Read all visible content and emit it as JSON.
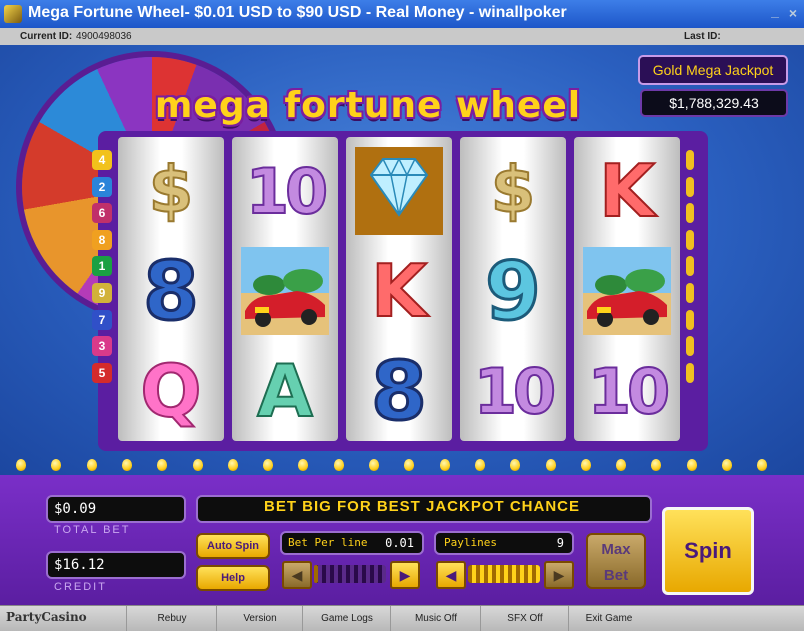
{
  "window": {
    "title": "Mega Fortune Wheel- $0.01 USD to $90 USD - Real Money - winallpoker"
  },
  "id_bar": {
    "current_label": "Current ID:",
    "current_value": "4900498036",
    "last_label": "Last ID:"
  },
  "logo": "mega fortune wheel",
  "jackpot": {
    "label": "Gold Mega Jackpot",
    "value": "$1,788,329.43"
  },
  "paylines_left": [
    {
      "n": "4",
      "color": "#f2c21b"
    },
    {
      "n": "2",
      "color": "#2a84d9"
    },
    {
      "n": "6",
      "color": "#c0306a"
    },
    {
      "n": "8",
      "color": "#f0a020"
    },
    {
      "n": "1",
      "color": "#1aa043"
    },
    {
      "n": "9",
      "color": "#d2b23a"
    },
    {
      "n": "7",
      "color": "#3050c8"
    },
    {
      "n": "3",
      "color": "#d93a8a"
    },
    {
      "n": "5",
      "color": "#d42b2b"
    }
  ],
  "reels": [
    [
      "$",
      "8",
      "Q"
    ],
    [
      "10",
      "car",
      "A"
    ],
    [
      "diamond",
      "K",
      "8"
    ],
    [
      "$",
      "9",
      "10"
    ],
    [
      "K",
      "car",
      "10"
    ]
  ],
  "panel": {
    "total_bet": "$0.09",
    "total_bet_label": "TOTAL BET",
    "credit": "$16.12",
    "credit_label": "CREDIT",
    "message": "BET BIG FOR BEST JACKPOT CHANCE",
    "auto_spin": "Auto Spin",
    "help": "Help",
    "bet_per_line_label": "Bet Per line",
    "bet_per_line_value": "0.01",
    "paylines_label": "Paylines",
    "paylines_value": "9",
    "max_bet": "Max Bet",
    "spin": "Spin",
    "bet_slider_level": 0.05,
    "paylines_slider_level": 1.0
  },
  "status_bar": {
    "brand": "PartyCasino",
    "items": [
      "Rebuy",
      "Version",
      "Game Logs",
      "Music Off",
      "SFX Off",
      "Exit Game"
    ]
  }
}
